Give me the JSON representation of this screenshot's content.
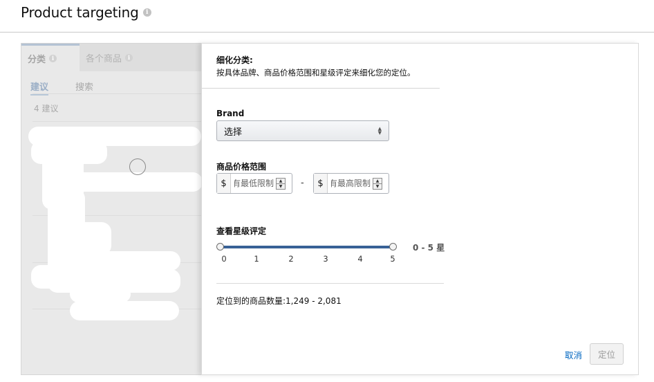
{
  "page": {
    "title": "Product targeting",
    "info_icon": "info-icon"
  },
  "left_panel": {
    "tabs": [
      {
        "label": "分类",
        "active": true
      },
      {
        "label": "各个商品",
        "active": false
      }
    ],
    "subtabs": [
      {
        "label": "建议",
        "active": true
      },
      {
        "label": "搜索",
        "active": false
      }
    ],
    "count_text": "4 建议"
  },
  "popover": {
    "header_title": "细化分类:",
    "header_desc": "按具体品牌、商品价格范围和星级评定来细化您的定位。",
    "brand": {
      "label": "Brand",
      "selected": "选择"
    },
    "price": {
      "label": "商品价格范围",
      "currency": "$",
      "min_placeholder": "没有最低限制",
      "max_placeholder": "没有最高限制",
      "separator": "-"
    },
    "rating": {
      "label": "查看星级评定",
      "min": 0,
      "max": 5,
      "ticks": [
        "0",
        "1",
        "2",
        "3",
        "4",
        "5"
      ],
      "range_text": "0 - 5 星"
    },
    "result_text": "定位到的商品数量:1,249 - 2,081",
    "cancel_label": "取消",
    "target_label": "定位"
  },
  "colors": {
    "slider_fill": "#386196",
    "link": "#0066c0"
  }
}
